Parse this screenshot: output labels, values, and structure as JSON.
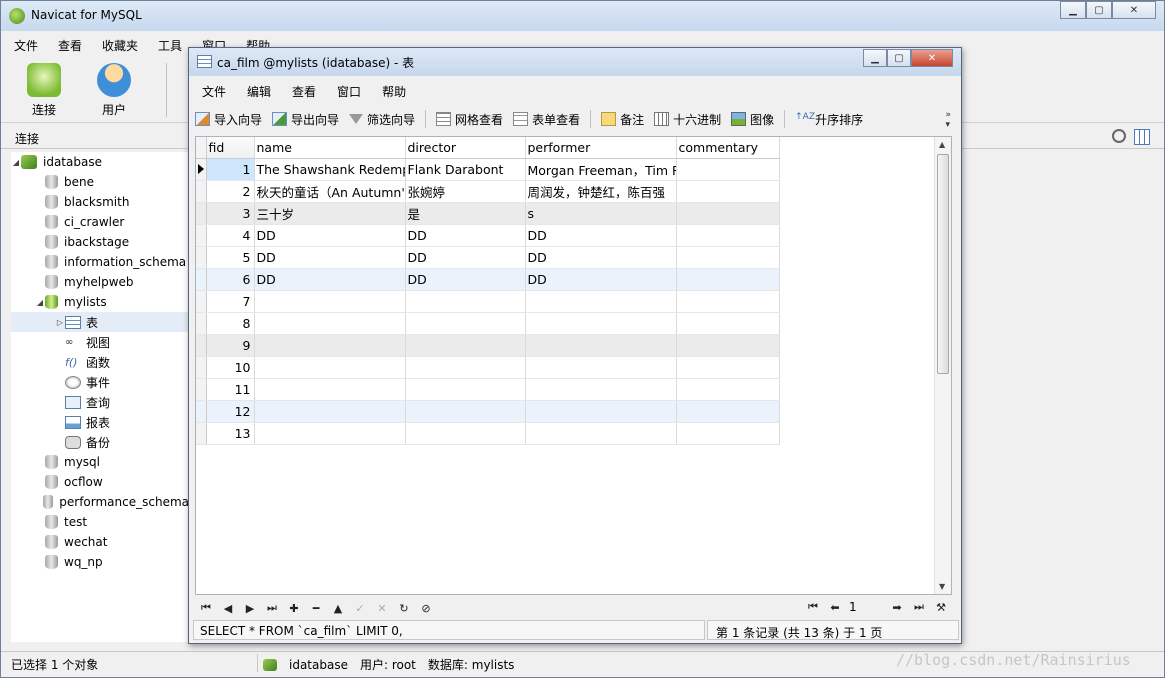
{
  "main_window": {
    "title": "Navicat for MySQL",
    "menu": [
      "文件",
      "查看",
      "收藏夹",
      "工具",
      "窗口",
      "帮助"
    ],
    "toolbar": {
      "connect_label": "连接",
      "user_label": "用户"
    },
    "connection_bar_label": "连接"
  },
  "tree": {
    "server": "idatabase",
    "databases": [
      "bene",
      "blacksmith",
      "ci_crawler",
      "ibackstage",
      "information_schema",
      "myhelpweb",
      "mylists",
      "mysql",
      "ocflow",
      "performance_schema",
      "test",
      "wechat",
      "wq_np"
    ],
    "open_database": "mylists",
    "objects": [
      "表",
      "视图",
      "函数",
      "事件",
      "查询",
      "报表",
      "备份"
    ]
  },
  "status_bar": {
    "selection": "已选择 1 个对象",
    "server": "idatabase",
    "user": "用户: root",
    "database": "数据库: mylists"
  },
  "watermark": "//blog.csdn.net/Rainsirius",
  "table_window": {
    "title": "ca_film @mylists (idatabase) - 表",
    "menu": [
      "文件",
      "编辑",
      "查看",
      "窗口",
      "帮助"
    ],
    "toolbar": {
      "import": "导入向导",
      "export": "导出向导",
      "filter": "筛选向导",
      "grid_view": "网格查看",
      "form_view": "表单查看",
      "memo": "备注",
      "hex": "十六进制",
      "image": "图像",
      "sort_asc": "升序排序"
    },
    "columns": [
      "fid",
      "name",
      "director",
      "performer",
      "commentary"
    ],
    "rows": [
      {
        "fid": "1",
        "name": "The Shawshank Redempt",
        "director": "Flank Darabont",
        "performer": "Morgan Freeman，Tim R",
        "commentary": ""
      },
      {
        "fid": "2",
        "name": "秋天的童话（An Autumn's",
        "director": "张婉婷",
        "performer": "周润发，钟楚红，陈百强",
        "commentary": ""
      },
      {
        "fid": "3",
        "name": "三十岁",
        "director": "是",
        "performer": "s",
        "commentary": ""
      },
      {
        "fid": "4",
        "name": "DD",
        "director": "DD",
        "performer": "DD",
        "commentary": ""
      },
      {
        "fid": "5",
        "name": "DD",
        "director": "DD",
        "performer": "DD",
        "commentary": ""
      },
      {
        "fid": "6",
        "name": "DD",
        "director": "DD",
        "performer": "DD",
        "commentary": ""
      },
      {
        "fid": "7",
        "name": "",
        "director": "",
        "performer": "",
        "commentary": ""
      },
      {
        "fid": "8",
        "name": "",
        "director": "",
        "performer": "",
        "commentary": ""
      },
      {
        "fid": "9",
        "name": "",
        "director": "",
        "performer": "",
        "commentary": ""
      },
      {
        "fid": "10",
        "name": "",
        "director": "",
        "performer": "",
        "commentary": ""
      },
      {
        "fid": "11",
        "name": "",
        "director": "",
        "performer": "",
        "commentary": ""
      },
      {
        "fid": "12",
        "name": "",
        "director": "",
        "performer": "",
        "commentary": ""
      },
      {
        "fid": "13",
        "name": "",
        "director": "",
        "performer": "",
        "commentary": ""
      }
    ],
    "current_page": "1",
    "sql": "SELECT * FROM `ca_film` LIMIT 0,",
    "record_info": "第 1 条记录 (共 13 条) 于 1 页"
  }
}
